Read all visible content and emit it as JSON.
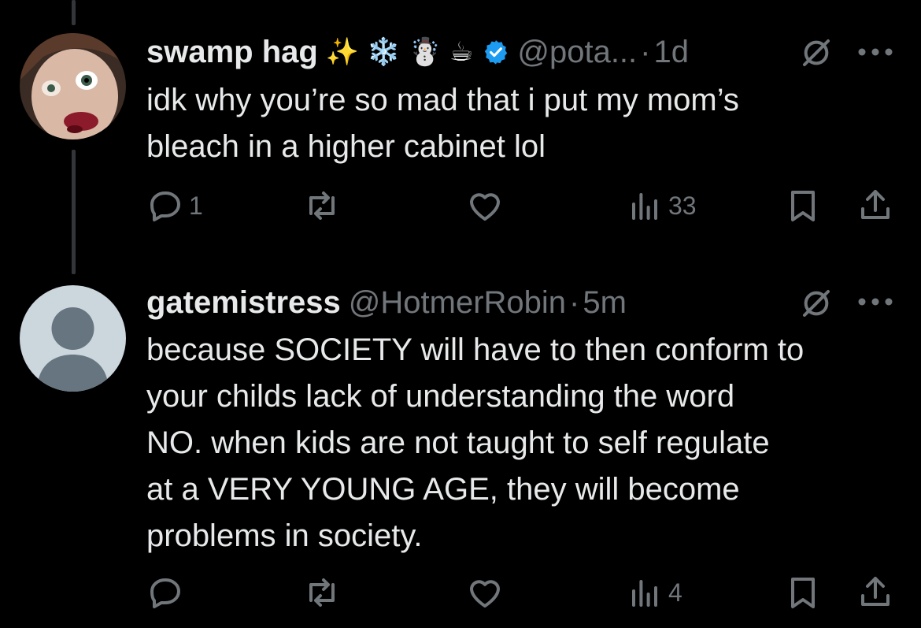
{
  "tweets": [
    {
      "display_name": "swamp hag",
      "emojis": [
        "✨",
        "❄️",
        "☃️",
        "☕"
      ],
      "verified": true,
      "handle": "@pota...",
      "separator": "·",
      "time": "1d",
      "text_lines": [
        "idk why you’re so mad that i put my mom’s",
        "bleach in a higher cabinet lol"
      ],
      "replies": "1",
      "reposts": "",
      "likes": "",
      "views": "33"
    },
    {
      "display_name": "gatemistress",
      "handle": "@HotmerRobin",
      "separator": "·",
      "time": "5m",
      "text_lines": [
        "because SOCIETY will have to then conform to",
        "your childs lack of understanding the word",
        "NO.  when kids are not taught to self regulate",
        "at a VERY YOUNG AGE, they will become",
        "problems in society."
      ],
      "replies": "",
      "reposts": "",
      "likes": "",
      "views": "4"
    }
  ],
  "icons": {
    "reply": "reply-icon",
    "repost": "repost-icon",
    "like": "heart-icon",
    "views": "views-icon",
    "bookmark": "bookmark-icon",
    "share": "share-icon",
    "mute": "mute-icon",
    "more": "more-icon",
    "verified": "verified-badge-icon"
  },
  "colors": {
    "background": "#000000",
    "text": "#e7e9ea",
    "muted": "#71767b",
    "verified": "#1d9bf0",
    "thread_line": "#333639",
    "default_avatar_bg": "#ccd6dd",
    "default_avatar_fg": "#66757f"
  }
}
